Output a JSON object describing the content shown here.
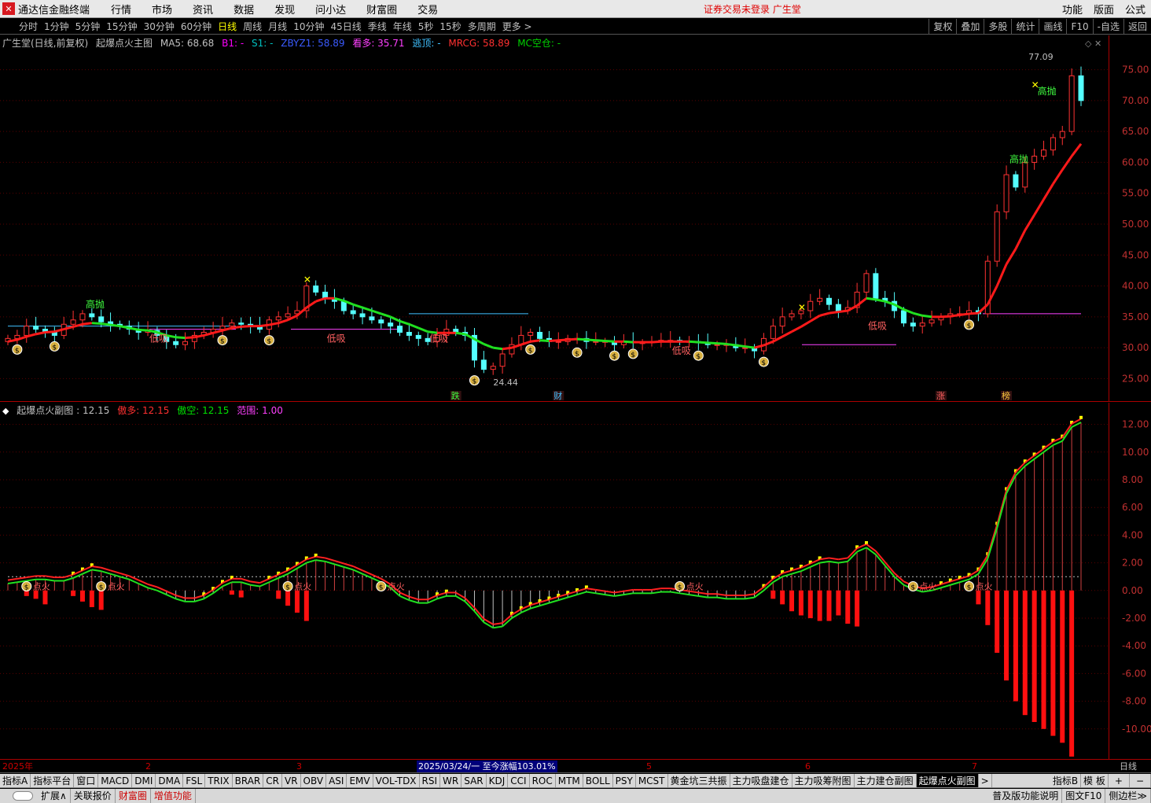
{
  "menubar": {
    "app_name": "通达信金融终端",
    "items": [
      "行情",
      "市场",
      "资讯",
      "数据",
      "发现",
      "问小达",
      "财富圈",
      "交易"
    ],
    "status": "证券交易未登录  广生堂",
    "right_items": [
      "功能",
      "版面",
      "公式"
    ]
  },
  "periods": {
    "items": [
      "分时",
      "1分钟",
      "5分钟",
      "15分钟",
      "30分钟",
      "60分钟",
      "日线",
      "周线",
      "月线",
      "10分钟",
      "45日线",
      "季线",
      "年线",
      "5秒",
      "15秒",
      "多周期",
      "更多 >"
    ],
    "active_index": 6
  },
  "toolbar_right": [
    "复权",
    "叠加",
    "多股",
    "统计",
    "画线",
    "F10",
    "-自选",
    "返回"
  ],
  "main_indicator": {
    "stock": "广生堂(日线,前复权)",
    "name": "起爆点火主图",
    "ma5": "MA5: 68.68",
    "b1": "B1: -",
    "s1": "S1: -",
    "zbyz1": "ZBYZ1: 58.89",
    "kanduo": "看多: 35.71",
    "taoding": "逃顶: -",
    "mrcg": "MRCG: 58.89",
    "mckc": "MC空仓: -"
  },
  "sub_indicator": {
    "name": "起爆点火副图",
    "value": ": 12.15",
    "aoduo": "傲多: 12.15",
    "aokong": "傲空: 12.15",
    "fanwei": "范围: 1.00"
  },
  "price_axis": {
    "labels": [
      "75.00",
      "70.00",
      "65.00",
      "60.00",
      "55.00",
      "50.00",
      "45.00",
      "40.00",
      "35.00",
      "30.00",
      "25.00"
    ],
    "values": [
      75,
      70,
      65,
      60,
      55,
      50,
      45,
      40,
      35,
      30,
      25
    ]
  },
  "sub_axis": {
    "labels": [
      "12.00",
      "10.00",
      "8.00",
      "6.00",
      "4.00",
      "2.00",
      "0.00",
      "-2.00",
      "-4.00",
      "-6.00",
      "-8.00",
      "-10.00"
    ],
    "values": [
      12,
      10,
      8,
      6,
      4,
      2,
      0,
      -2,
      -4,
      -6,
      -8,
      -10
    ]
  },
  "annotations": {
    "high": "77.09",
    "low": "24.44",
    "gaopao": "高抛",
    "dixi": "低吸",
    "die": "跌",
    "cai": "财",
    "zhang": "涨",
    "bang": "榜",
    "money": "$",
    "huoqi": "点火"
  },
  "dates": {
    "year": "2025年",
    "months": [
      "2",
      "3",
      "5",
      "6",
      "7"
    ],
    "highlight": "2025/03/24/一  至今涨幅103.01%",
    "period": "日线"
  },
  "tabs": {
    "items": [
      "指标A",
      "指标平台",
      "窗口",
      "MACD",
      "DMI",
      "DMA",
      "FSL",
      "TRIX",
      "BRAR",
      "CR",
      "VR",
      "OBV",
      "ASI",
      "EMV",
      "VOL-TDX",
      "RSI",
      "WR",
      "SAR",
      "KDJ",
      "CCI",
      "ROC",
      "MTM",
      "BOLL",
      "PSY",
      "MCST",
      "黄金坑三共振",
      "主力吸盘建仓",
      "主力吸筹附图",
      "主力建仓副图",
      "起爆点火副图"
    ],
    "active_index": 29,
    "more": ">",
    "right_items": [
      "指标B",
      "模 板",
      "+",
      "−"
    ]
  },
  "bottombar": {
    "items": [
      "扩展∧",
      "关联报价",
      "财富圈",
      "增值功能"
    ],
    "right_items": [
      "普及版功能说明",
      "图文F10",
      "侧边栏≫"
    ]
  },
  "chart_data": [
    {
      "type": "candlestick",
      "title": "起爆点火主图",
      "ylim": [
        22,
        78
      ],
      "close": [
        31.5,
        32,
        33.5,
        33,
        32.5,
        32,
        33.8,
        34.5,
        35.5,
        35,
        34.2,
        33.8,
        33.5,
        33,
        32.5,
        32.8,
        32,
        31,
        30.5,
        31,
        32,
        32.5,
        33,
        33.5,
        34,
        33.8,
        33.5,
        33,
        34.5,
        35,
        35.5,
        36,
        40,
        39,
        38,
        37.5,
        36,
        35.5,
        35,
        34.5,
        34,
        33.5,
        32.5,
        32,
        31.5,
        31,
        32,
        33,
        32.5,
        32,
        28,
        26.5,
        27,
        29,
        30.5,
        32,
        32.5,
        31.5,
        31,
        31,
        31.5,
        31.5,
        31,
        31,
        31,
        30.5,
        31,
        30.8,
        30.8,
        31,
        31.2,
        31.2,
        31,
        31,
        30.8,
        30.5,
        30.5,
        30.5,
        30,
        30,
        29.5,
        31.5,
        33.5,
        35,
        35.5,
        36,
        37.5,
        38,
        37,
        36,
        36.5,
        39,
        42,
        38,
        37.5,
        36,
        34,
        33.5,
        34,
        34.5,
        35,
        35.5,
        35.5,
        36,
        35.5,
        44,
        52,
        58,
        56,
        60,
        61,
        62,
        64,
        65,
        74,
        70
      ],
      "ma": [
        31,
        31.3,
        31.8,
        32.2,
        32.5,
        32.6,
        33,
        33.4,
        33.8,
        34,
        33.9,
        33.7,
        33.5,
        33.2,
        32.9,
        32.8,
        32.5,
        32,
        31.7,
        31.6,
        31.7,
        32,
        32.4,
        32.8,
        33.2,
        33.4,
        33.5,
        33.5,
        33.7,
        34,
        34.5,
        35.2,
        36.5,
        37.5,
        38,
        38,
        37.6,
        37,
        36.5,
        36,
        35.5,
        35,
        34.3,
        33.8,
        33.2,
        32.6,
        32.4,
        32.4,
        32.4,
        32.2,
        31.4,
        30.6,
        30,
        29.8,
        30,
        30.5,
        31,
        31.2,
        31.1,
        31.2,
        31.3,
        31.4,
        31.3,
        31.2,
        31.1,
        31,
        31,
        30.9,
        30.9,
        30.9,
        31,
        31,
        31,
        31,
        30.9,
        30.8,
        30.7,
        30.6,
        30.4,
        30.2,
        30,
        30.4,
        31,
        31.8,
        32.6,
        33.4,
        34.3,
        35.2,
        35.6,
        35.8,
        36,
        36.8,
        38,
        37.8,
        37.5,
        37,
        36.2,
        35.6,
        35.2,
        35,
        35,
        35.1,
        35.3,
        35.5,
        35.6,
        37,
        40,
        43.5,
        46,
        49,
        51.5,
        54,
        56.5,
        58.8,
        61,
        63
      ]
    },
    {
      "type": "line",
      "title": "起爆点火副图",
      "ylim": [
        -12,
        13
      ],
      "aoduo": [
        0.5,
        0.6,
        0.7,
        0.8,
        0.8,
        0.7,
        0.7,
        0.9,
        1.2,
        1.5,
        1.4,
        1.2,
        1,
        0.8,
        0.5,
        0.2,
        0,
        -0.3,
        -0.6,
        -0.8,
        -0.8,
        -0.6,
        -0.2,
        0.3,
        0.6,
        0.6,
        0.4,
        0.3,
        0.6,
        0.9,
        1.2,
        1.6,
        2,
        2.2,
        2.1,
        1.9,
        1.7,
        1.5,
        1.2,
        0.9,
        0.6,
        0.2,
        -0.4,
        -0.7,
        -0.9,
        -0.9,
        -0.6,
        -0.4,
        -0.4,
        -0.8,
        -1.5,
        -2.3,
        -2.7,
        -2.6,
        -2,
        -1.6,
        -1.3,
        -1.1,
        -0.9,
        -0.7,
        -0.5,
        -0.3,
        -0.1,
        -0.2,
        -0.3,
        -0.4,
        -0.3,
        -0.2,
        -0.2,
        -0.2,
        -0.1,
        -0.1,
        -0.2,
        -0.3,
        -0.4,
        -0.5,
        -0.5,
        -0.6,
        -0.6,
        -0.6,
        -0.5,
        0,
        0.6,
        1,
        1.2,
        1.4,
        1.7,
        2,
        2.1,
        2,
        2.1,
        2.8,
        3.1,
        2.6,
        1.8,
        1,
        0.4,
        0.1,
        -0.1,
        0,
        0.2,
        0.4,
        0.6,
        0.8,
        1.2,
        2.3,
        4.5,
        7,
        8.3,
        9,
        9.5,
        10,
        10.5,
        10.8,
        11.8,
        12.15
      ],
      "hist": [
        0,
        0,
        -0.4,
        -0.6,
        -1,
        0,
        0,
        -0.4,
        -0.8,
        -1.2,
        -1.4,
        0,
        0,
        0,
        0,
        0,
        0,
        0,
        0,
        0,
        0,
        0,
        0,
        0,
        -0.3,
        -0.5,
        0,
        0,
        0,
        -0.6,
        -1.1,
        -1.6,
        -2.2,
        0,
        0,
        0,
        0,
        0,
        0,
        0,
        0,
        0,
        0,
        0,
        0,
        0,
        0,
        0,
        0,
        0,
        0,
        0,
        0,
        0,
        0,
        0,
        0,
        0,
        0,
        0,
        0,
        0,
        0,
        0,
        0,
        0,
        0,
        0,
        0,
        0,
        0,
        0,
        0,
        0,
        0,
        0,
        0,
        0,
        0,
        0,
        0,
        0,
        -0.6,
        -1,
        -1.5,
        -1.8,
        -2,
        -2.2,
        -2.2,
        -1.8,
        -2.4,
        -2.6,
        0,
        0,
        0,
        0,
        0,
        0,
        0,
        0,
        0,
        0,
        0,
        0,
        -1,
        -2.5,
        -4.5,
        -6.5,
        -8,
        -9,
        -9.5,
        -10,
        -10.5,
        -11,
        -12
      ]
    }
  ]
}
